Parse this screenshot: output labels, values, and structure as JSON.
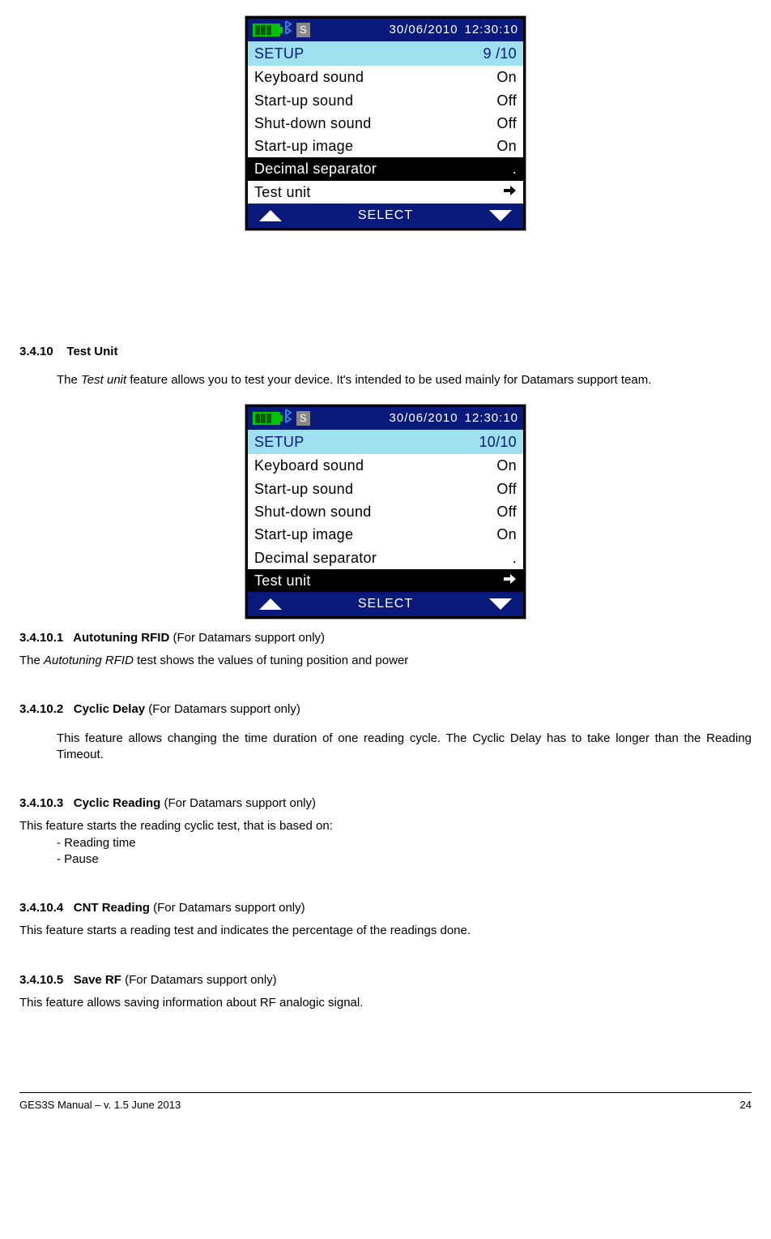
{
  "screens": {
    "a": {
      "date": "30/06/2010",
      "time": "12:30:10",
      "signal": "S",
      "setup_label": "SETUP",
      "setup_index": "9 /10",
      "rows": [
        {
          "label": "Keyboard sound",
          "value": "On",
          "selected": false
        },
        {
          "label": "Start-up sound",
          "value": "Off",
          "selected": false
        },
        {
          "label": "Shut-down sound",
          "value": "Off",
          "selected": false
        },
        {
          "label": "Start-up image",
          "value": "On",
          "selected": false
        },
        {
          "label": "Decimal separator",
          "value": ".",
          "selected": true,
          "arrow": false
        },
        {
          "label": "Test unit",
          "value": "",
          "selected": false,
          "arrow": true
        }
      ],
      "select_label": "SELECT"
    },
    "b": {
      "date": "30/06/2010",
      "time": "12:30:10",
      "signal": "S",
      "setup_label": "SETUP",
      "setup_index": "10/10",
      "rows": [
        {
          "label": "Keyboard sound",
          "value": "On",
          "selected": false
        },
        {
          "label": "Start-up sound",
          "value": "Off",
          "selected": false
        },
        {
          "label": "Shut-down sound",
          "value": "Off",
          "selected": false
        },
        {
          "label": "Start-up image",
          "value": "On",
          "selected": false
        },
        {
          "label": "Decimal separator",
          "value": ".",
          "selected": false
        },
        {
          "label": "Test unit",
          "value": "",
          "selected": true,
          "arrow": true
        }
      ],
      "select_label": "SELECT"
    }
  },
  "sec_3_4_10": {
    "num": "3.4.10",
    "title": "Test Unit",
    "body_pre": "The ",
    "body_italic": "Test unit",
    "body_post": " feature allows you to test your device. It's intended to be used mainly for Datamars support team."
  },
  "sec_1": {
    "num": "3.4.10.1",
    "title": "Autotuning RFID",
    "note": " (For Datamars support only)",
    "body_pre": "The ",
    "body_italic": "Autotuning RFID",
    "body_post": " test shows the values of tuning position and power"
  },
  "sec_2": {
    "num": "3.4.10.2",
    "title": "Cyclic Delay",
    "note": " (For Datamars support only)",
    "body": "This feature allows changing the time duration of one reading cycle. The Cyclic Delay has to take longer than the Reading Timeout."
  },
  "sec_3": {
    "num": "3.4.10.3",
    "title": "Cyclic Reading",
    "note": " (For Datamars support only)",
    "body": "This feature starts the reading cyclic test, that is based on:",
    "items": [
      "Reading time",
      "Pause"
    ]
  },
  "sec_4": {
    "num": "3.4.10.4",
    "title": "CNT Reading",
    "note": " (For Datamars support only)",
    "body": "This feature starts a reading test and indicates the percentage of the readings done."
  },
  "sec_5": {
    "num": "3.4.10.5",
    "title": "Save RF",
    "note": " (For Datamars support only)",
    "body": "This feature allows saving information about RF analogic signal."
  },
  "footer": {
    "left": "GES3S Manual – v. 1.5  June 2013",
    "right": "24"
  }
}
